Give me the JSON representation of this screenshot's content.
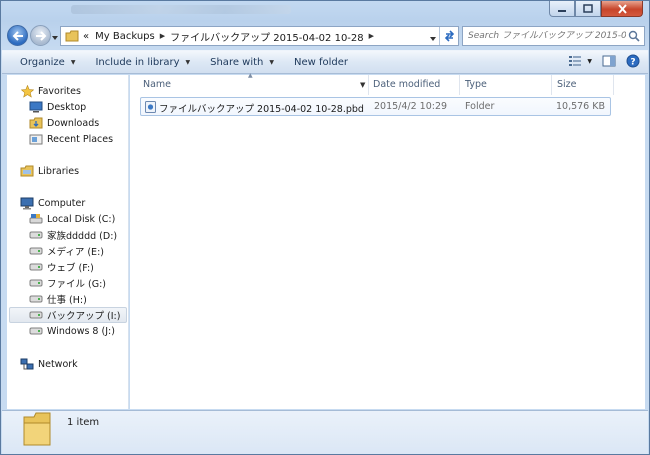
{
  "window": {
    "close_icon": "close-icon",
    "maximize_icon": "maximize-icon",
    "minimize_icon": "minimize-icon"
  },
  "address": {
    "overflow": "«",
    "crumbs": [
      "My Backups",
      "ファイルバックアップ 2015-04-02 10-28"
    ],
    "search_placeholder": "Search ファイルバックアップ 2015-0..."
  },
  "toolbar": {
    "organize": "Organize",
    "include_in_library": "Include in library",
    "share_with": "Share with",
    "new_folder": "New folder"
  },
  "nav": {
    "favorites": "Favorites",
    "desktop": "Desktop",
    "downloads": "Downloads",
    "recent_places": "Recent Places",
    "libraries": "Libraries",
    "computer": "Computer",
    "drives": [
      "Local Disk (C:)",
      "家族ddddd (D:)",
      "メディア (E:)",
      "ウェブ (F:)",
      "ファイル (G:)",
      "仕事 (H:)",
      "バックアップ (I:)",
      "Windows 8 (J:)"
    ],
    "network": "Network"
  },
  "columns": {
    "name": "Name",
    "date_modified": "Date modified",
    "type": "Type",
    "size": "Size"
  },
  "files": [
    {
      "name": "ファイルバックアップ 2015-04-02 10-28.pbd",
      "date_modified": "2015/4/2 10:29",
      "type": "Folder",
      "size": "10,576 KB"
    }
  ],
  "details": {
    "item_count": "1 item"
  },
  "colors": {
    "accent": "#3e6aa6",
    "selection_border": "#a9c4e4",
    "toolbar_text": "#1e395b"
  }
}
